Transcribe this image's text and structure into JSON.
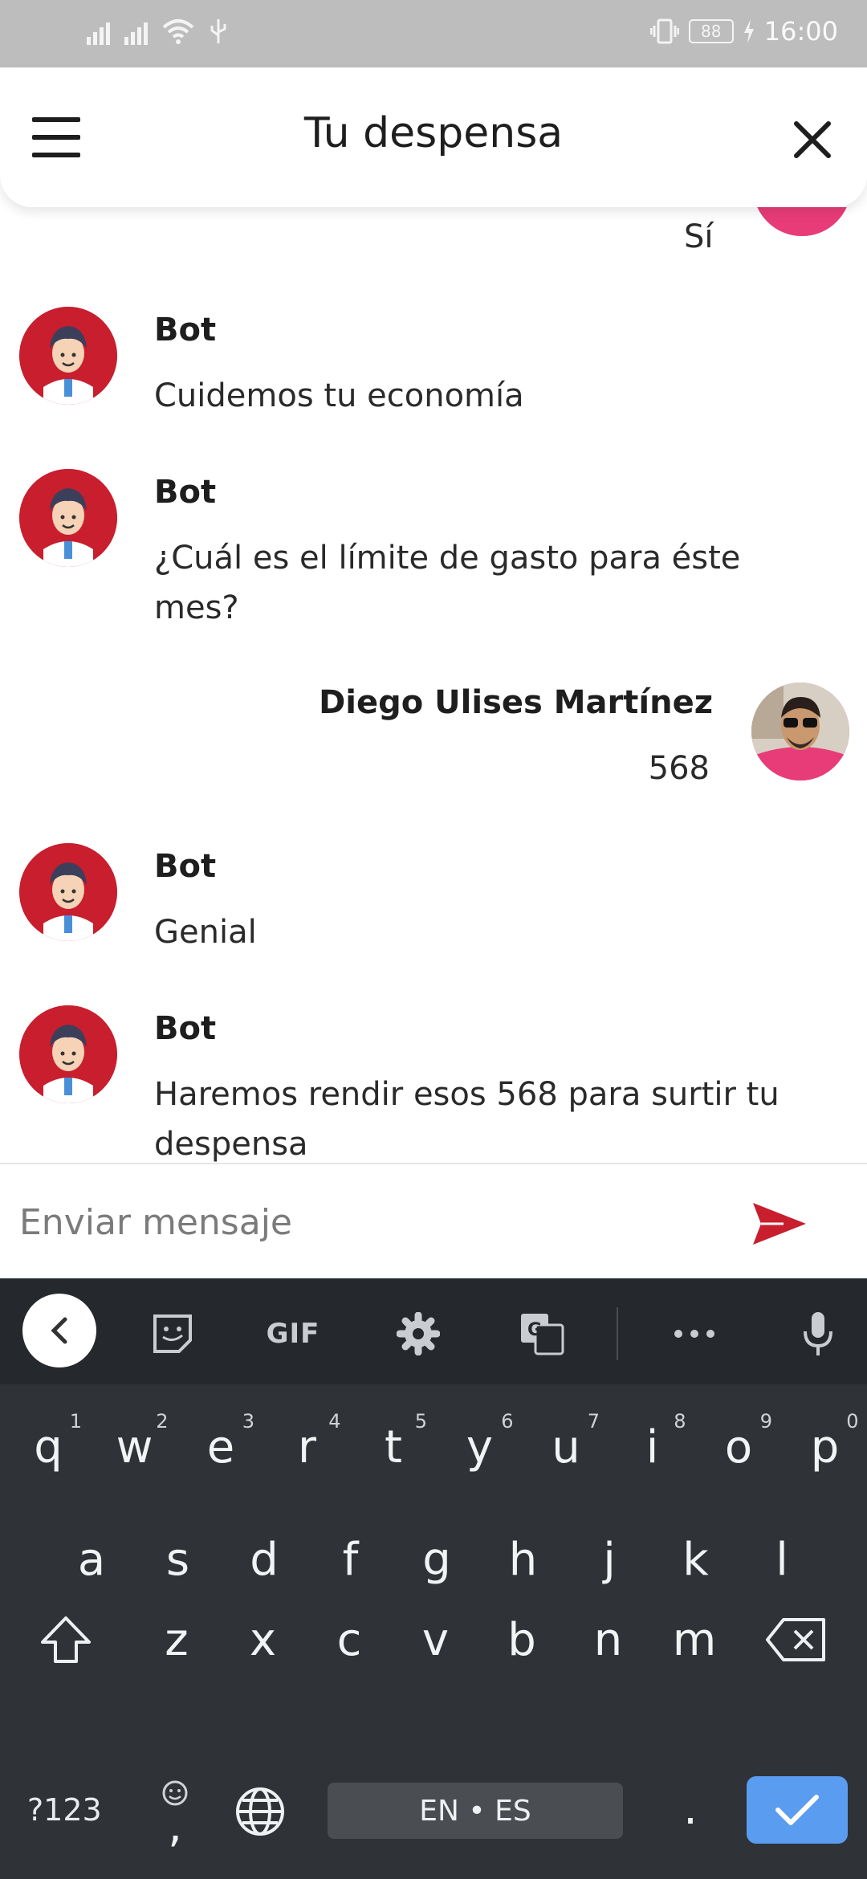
{
  "status_bar": {
    "time": "16:00",
    "battery": "88"
  },
  "header": {
    "title": "Tu despensa"
  },
  "chat": {
    "messages": [
      {
        "sender": "Diego Ulises Martínez",
        "role": "user",
        "text": "Sí"
      },
      {
        "sender": "Bot",
        "role": "bot",
        "text": "Cuidemos tu economía"
      },
      {
        "sender": "Bot",
        "role": "bot",
        "text": "¿Cuál es el límite de gasto para éste mes?"
      },
      {
        "sender": "Diego Ulises Martínez",
        "role": "user",
        "text": "568"
      },
      {
        "sender": "Bot",
        "role": "bot",
        "text": "Genial"
      },
      {
        "sender": "Bot",
        "role": "bot",
        "text": "Haremos rendir esos 568 para surtir tu despensa"
      }
    ]
  },
  "input": {
    "placeholder": "Enviar mensaje",
    "value": ""
  },
  "keyboard": {
    "toolbar": {
      "gif": "GIF"
    },
    "row1": [
      {
        "k": "q",
        "n": "1"
      },
      {
        "k": "w",
        "n": "2"
      },
      {
        "k": "e",
        "n": "3"
      },
      {
        "k": "r",
        "n": "4"
      },
      {
        "k": "t",
        "n": "5"
      },
      {
        "k": "y",
        "n": "6"
      },
      {
        "k": "u",
        "n": "7"
      },
      {
        "k": "i",
        "n": "8"
      },
      {
        "k": "o",
        "n": "9"
      },
      {
        "k": "p",
        "n": "0"
      }
    ],
    "row2": [
      "a",
      "s",
      "d",
      "f",
      "g",
      "h",
      "j",
      "k",
      "l"
    ],
    "row3": [
      "z",
      "x",
      "c",
      "v",
      "b",
      "n",
      "m"
    ],
    "symbols_label": "?123",
    "comma": ",",
    "period": ".",
    "space_label": "EN • ES"
  },
  "colors": {
    "accent_red": "#c81e2e",
    "enter_blue": "#5a9cf0",
    "keyboard_bg": "#2f3237"
  },
  "icons": [
    "menu-icon",
    "close-icon",
    "send-icon",
    "back-icon",
    "sticker-icon",
    "settings-icon",
    "translate-icon",
    "more-icon",
    "mic-icon",
    "shift-icon",
    "backspace-icon",
    "emoji-icon",
    "globe-icon",
    "check-icon"
  ]
}
